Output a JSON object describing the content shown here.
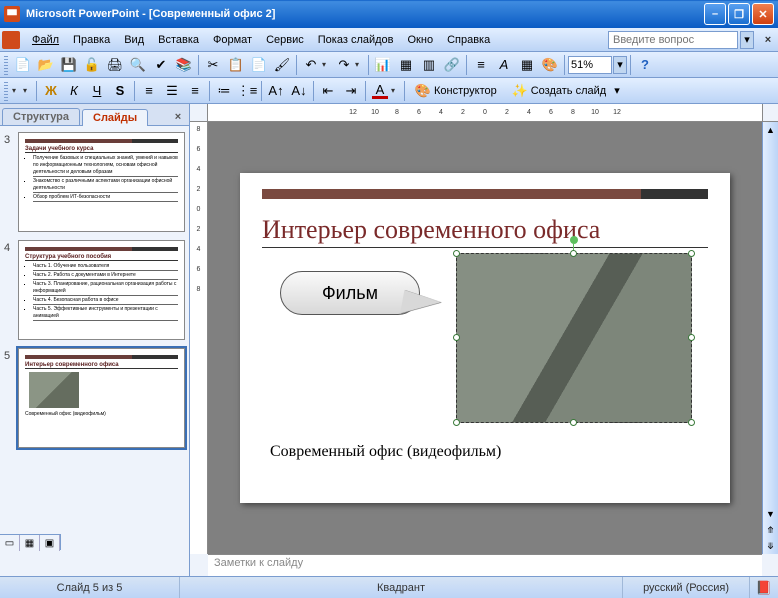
{
  "titlebar": {
    "app": "Microsoft PowerPoint",
    "doc": "[Современный офис 2]"
  },
  "menu": {
    "file": "Файл",
    "edit": "Правка",
    "view": "Вид",
    "insert": "Вставка",
    "format": "Формат",
    "tools": "Сервис",
    "slideshow": "Показ слайдов",
    "window": "Окно",
    "help": "Справка",
    "help_search_placeholder": "Введите вопрос"
  },
  "toolbar": {
    "zoom": "51%",
    "designer": "Конструктор",
    "new_slide": "Создать слайд"
  },
  "pane": {
    "tab_outline": "Структура",
    "tab_slides": "Слайды",
    "thumbs": [
      {
        "num": "3",
        "title": "Задачи учебного курса",
        "bullets": [
          "Получение базовых и специальных знаний, умений и навыков по информационным технологиям, основам офисной деятельности и деловым образам",
          "Знакомство с различными аспектами организации офисной деятельности",
          "Обзор проблем ИТ-безопасности"
        ]
      },
      {
        "num": "4",
        "title": "Структура учебного пособия",
        "bullets": [
          "Часть 1. Обучение пользователя",
          "Часть 2. Работа с документами в Интернете",
          "Часть 3. Планирование, рациональная организация работы с информацией",
          "Часть 4. Безопасная работа в офисе",
          "Часть 5. Эффективные инструменты и презентации с анимацией"
        ]
      },
      {
        "num": "5",
        "title": "Интерьер современного офиса",
        "caption": "Современный офис (видеофильм)"
      }
    ]
  },
  "slide": {
    "title": "Интерьер современного офиса",
    "callout": "Фильм",
    "caption": "Современный офис (видеофильм)"
  },
  "ruler": {
    "h": [
      "12",
      "10",
      "8",
      "6",
      "4",
      "2",
      "0",
      "2",
      "4",
      "6",
      "8",
      "10",
      "12"
    ],
    "v": [
      "8",
      "6",
      "4",
      "2",
      "0",
      "2",
      "4",
      "6",
      "8"
    ]
  },
  "notes": {
    "placeholder": "Заметки к слайду"
  },
  "status": {
    "slide_pos": "Слайд 5 из 5",
    "layout": "Квадрант",
    "lang": "русский (Россия)"
  }
}
